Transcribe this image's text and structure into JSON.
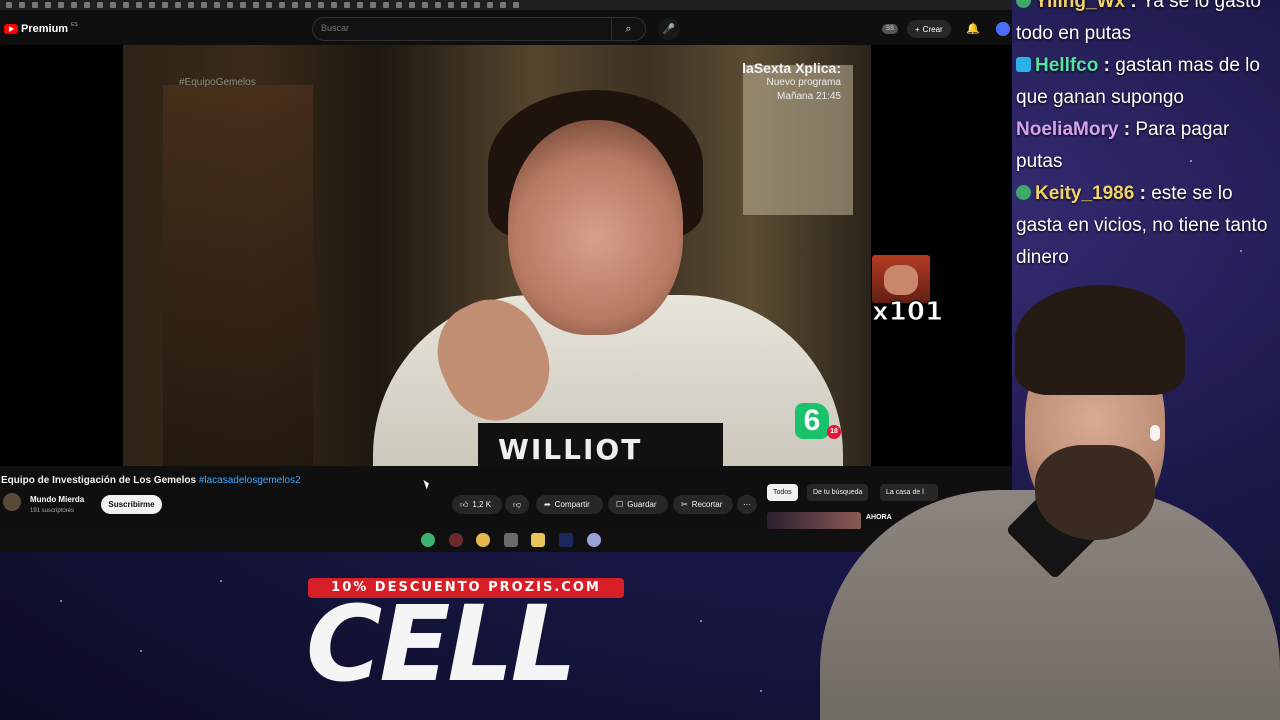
{
  "youtube": {
    "logo_text": "Premium",
    "logo_region": "ES",
    "search_placeholder": "Buscar",
    "header_badge": "SS",
    "create_label": "Crear",
    "create_icon": "plus-icon",
    "icons": [
      "search-icon",
      "mic-icon",
      "bell-icon",
      "avatar-icon"
    ]
  },
  "video": {
    "overlay_hashtag": "#EquipoGemelos",
    "promo_title": "laSexta Xplica:",
    "promo_line1": "Nuevo programa",
    "promo_line2": "Mañana 21:45",
    "channel_logo": "6",
    "age_rating": "18",
    "sweater_text": "WILLIOT",
    "emote_count": "x101"
  },
  "meta": {
    "title": "Equipo de Investigación de Los Gemelos",
    "title_hashtag": "#lacasadelosgemelos2",
    "channel": "Mundo Mierda",
    "subscribers": "191 suscriptores",
    "subscribe_label": "Suscribirme"
  },
  "actions": {
    "likes": "1,2 K",
    "share": "Compartir",
    "save": "Guardar",
    "clip": "Recortar",
    "more": "···"
  },
  "chips": [
    {
      "label": "Todos",
      "active": true
    },
    {
      "label": "De tu búsqueda",
      "active": false
    },
    {
      "label": "La casa de l",
      "active": false
    }
  ],
  "recommendation": {
    "title": "AHORA"
  },
  "chat": [
    {
      "user": "Yiling_Wx",
      "text": "Ya se lo gasto todo en putas",
      "color": "#f2d36b",
      "badge": "chat-badge-icon"
    },
    {
      "user": "Hellfco",
      "text": "gastan mas de lo que ganan supongo",
      "color": "#58e0a3",
      "badge": "cube-icon"
    },
    {
      "user": "NoeliaMory",
      "text": "Para pagar putas",
      "color": "#d6a3f0",
      "badge": ""
    },
    {
      "user": "Keity_1986",
      "text": "este se lo gasta en vicios, no tiene tanto dinero",
      "color": "#f2d36b",
      "badge": "chat-badge-icon"
    }
  ],
  "sponsor": {
    "tag": "10% DESCUENTO PROZIS.COM",
    "big_text": "CELL"
  },
  "colors": {
    "youtube_red": "#ff0000",
    "link_blue": "#3ea6ff",
    "sponsor_red": "#d61f26"
  }
}
